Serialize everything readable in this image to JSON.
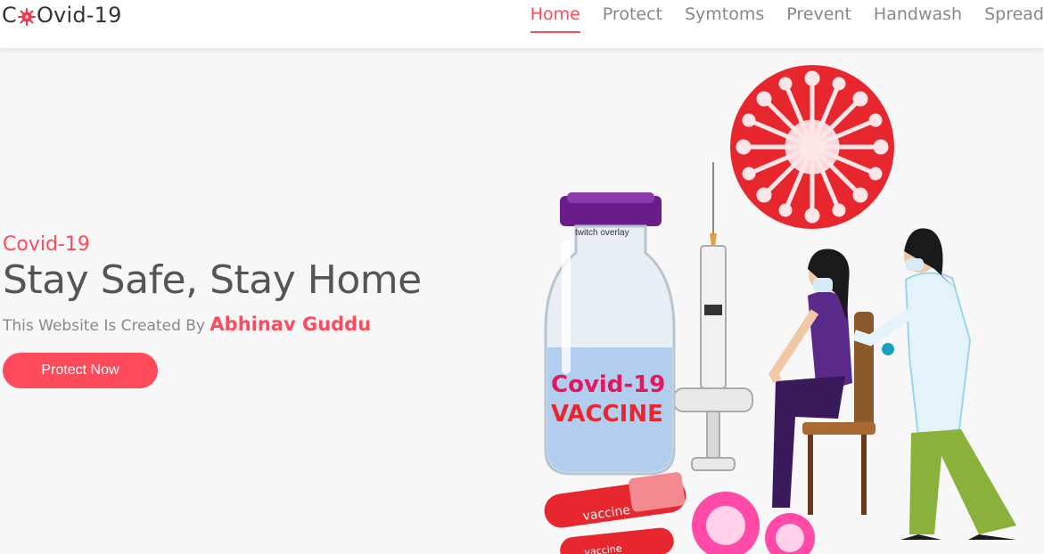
{
  "brand": {
    "prefix": "C",
    "suffix": "Ovid-19",
    "logo_icon": "virus-icon"
  },
  "nav": {
    "items": [
      {
        "label": "Home",
        "active": true
      },
      {
        "label": "Protect",
        "active": false
      },
      {
        "label": "Symtoms",
        "active": false
      },
      {
        "label": "Prevent",
        "active": false
      },
      {
        "label": "Handwash",
        "active": false
      },
      {
        "label": "Spread",
        "active": false
      }
    ]
  },
  "hero": {
    "subtitle": "Covid-19",
    "headline": "Stay Safe, Stay Home",
    "byline_text": "This Website Is Created By",
    "author": "Abhinav Guddu",
    "cta_label": "Protect Now"
  },
  "illustration": {
    "vial_label_line1": "Covid-19",
    "vial_label_line2": "VACCINE",
    "vial_cap_text": "twitch overlay",
    "tube_label_1": "vaccine",
    "tube_label_2": "vaccine"
  },
  "colors": {
    "accent": "#ff4a5b",
    "text_dark": "#555555",
    "text_muted": "#888888"
  }
}
